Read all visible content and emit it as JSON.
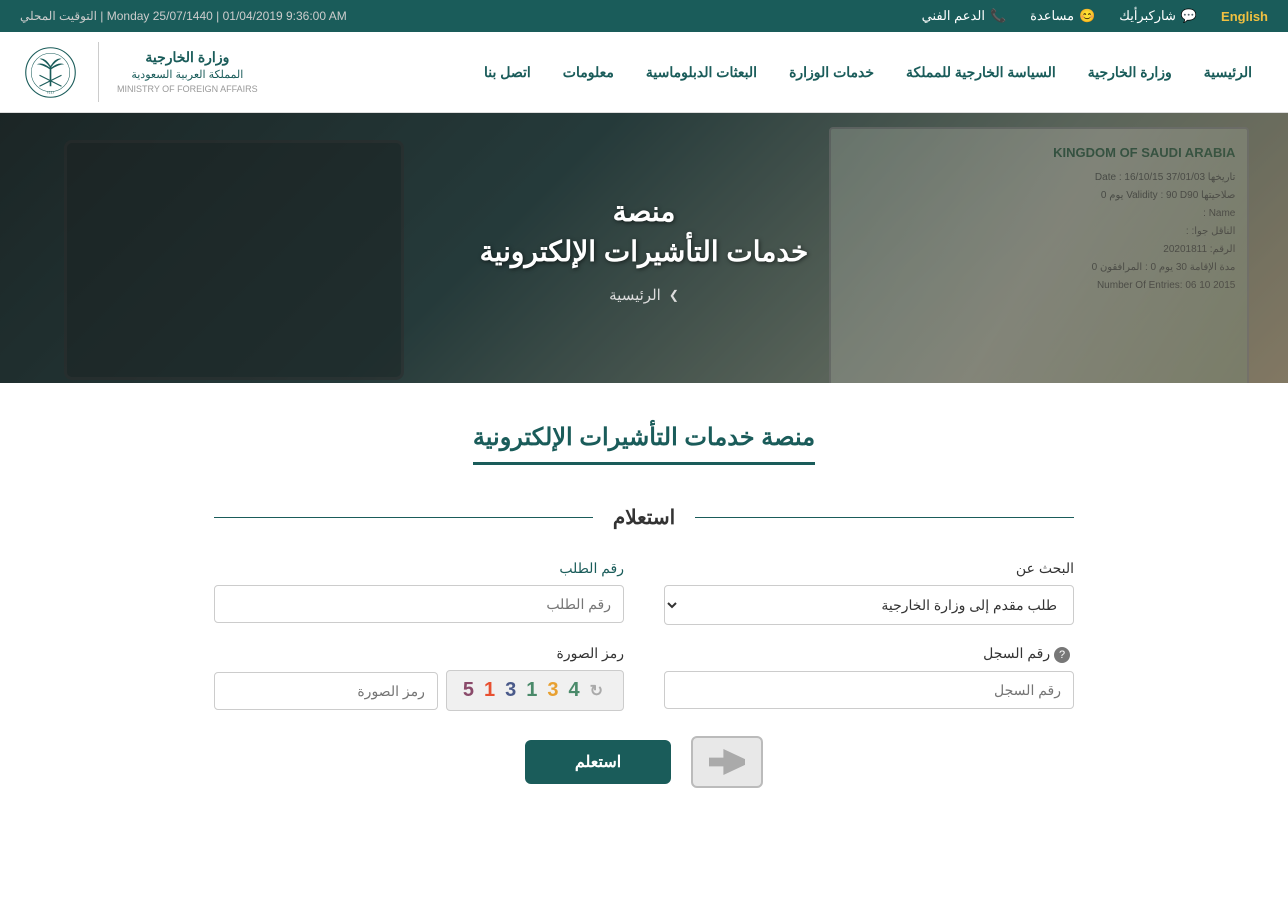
{
  "topbar": {
    "english_label": "English",
    "share_label": "شاركبرأيك",
    "share_icon": "chat-icon",
    "help_label": "مساعدة",
    "help_icon": "help-icon",
    "support_label": "الدعم الفني",
    "support_icon": "phone-icon",
    "datetime": "Monday 25/07/1440 | 01/04/2019 9:36:00 AM",
    "datetime_label": "التوقيت المحلي"
  },
  "nav": {
    "logo_title": "وزارة الخارجية",
    "logo_subtitle": "المملكة العربية السعودية",
    "logo_en": "MINISTRY OF FOREIGN AFFAIRS",
    "items": [
      {
        "id": "home",
        "label": "الرئيسية"
      },
      {
        "id": "foreign",
        "label": "وزارة الخارجية"
      },
      {
        "id": "foreign-policy",
        "label": "السياسة الخارجية للمملكة"
      },
      {
        "id": "ministry-services",
        "label": "خدمات الوزارة"
      },
      {
        "id": "diplomatic",
        "label": "البعثات الدبلوماسية"
      },
      {
        "id": "info",
        "label": "معلومات"
      },
      {
        "id": "contact",
        "label": "اتصل بنا"
      }
    ]
  },
  "hero": {
    "title_line1": "منصة",
    "title_line2": "خدمات التأشيرات الإلكترونية",
    "breadcrumb": "الرئيسية",
    "chevron": "❯"
  },
  "page": {
    "section_title": "منصة خدمات التأشيرات الإلكترونية",
    "inquiry_label": "استعلام",
    "fields": {
      "search_about_label": "البحث عن",
      "search_dropdown_default": "طلب مقدم إلى وزارة الخارجية",
      "request_number_label": "رقم الطلب",
      "request_number_placeholder": "رقم الطلب",
      "record_number_label": "رقم السجل",
      "record_number_placeholder": "رقم السجل",
      "captcha_label": "رمز الصورة",
      "captcha_placeholder": "رمز الصورة",
      "captcha_digits": [
        "4",
        "3",
        "1",
        "3",
        "1",
        "5"
      ],
      "inquiry_button": "استعلم"
    }
  }
}
